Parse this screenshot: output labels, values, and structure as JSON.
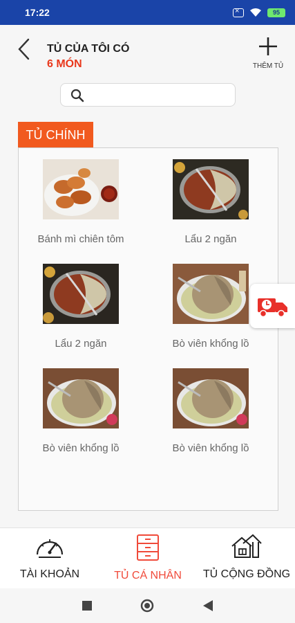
{
  "status_bar": {
    "time": "17:22",
    "battery": "95"
  },
  "header": {
    "title_line1": "TỦ CỦA TÔI CÓ",
    "title_line2": "6 MÓN",
    "add_label": "THÊM TỦ"
  },
  "search": {
    "value": "",
    "placeholder": ""
  },
  "section": {
    "label": "TỦ CHÍNH"
  },
  "items": [
    {
      "name": "Bánh mì chiên tôm",
      "image": "fried-shrimp-bread"
    },
    {
      "name": "Lẩu 2 ngăn",
      "image": "hotpot"
    },
    {
      "name": "Lẩu 2 ngăn",
      "image": "hotpot"
    },
    {
      "name": "Bò viên khổng lồ",
      "image": "giant-meatball"
    },
    {
      "name": "Bò viên khổng lồ",
      "image": "giant-meatball"
    },
    {
      "name": "Bò viên khổng lồ",
      "image": "giant-meatball"
    }
  ],
  "bottom_nav": [
    {
      "label": "TÀI KHOẢN",
      "icon": "speedometer-icon",
      "active": false
    },
    {
      "label": "TỦ CÁ NHÂN",
      "icon": "cabinet-icon",
      "active": true
    },
    {
      "label": "TỦ CỘNG ĐỒNG",
      "icon": "community-houses-icon",
      "active": false
    }
  ],
  "colors": {
    "accent": "#f15a1f",
    "title_red": "#e9381c",
    "status_bar": "#1a44a8",
    "active_nav": "#f04a3a"
  }
}
